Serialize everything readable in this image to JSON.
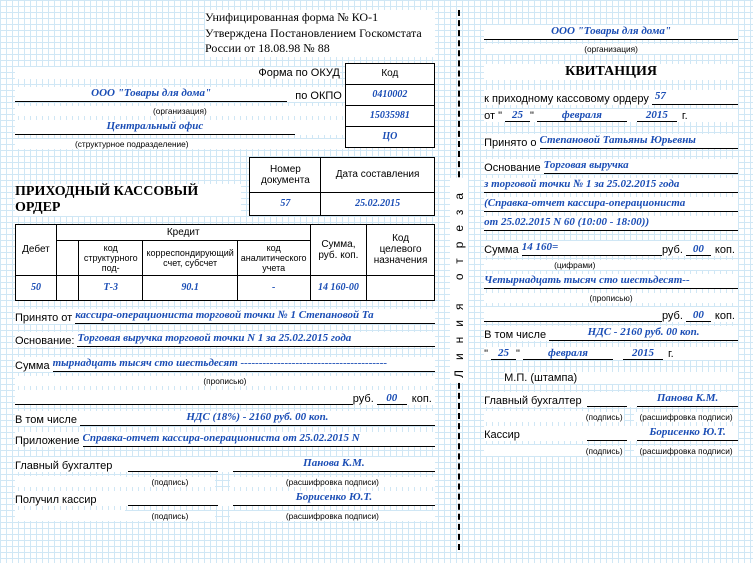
{
  "form": {
    "line1": "Унифицированная форма № КО-1",
    "line2": "Утверждена Постановлением Госкомстата",
    "line3": "России от 18.08.98 № 88"
  },
  "codes": {
    "kod": "Код",
    "okud_label": "Форма по ОКУД",
    "okud": "0410002",
    "okpo_label": "по ОКПО",
    "okpo": "15035981"
  },
  "org": {
    "name": "ООО \"Товары для дома\"",
    "org_sub": "(организация)",
    "unit": "Центральный офис",
    "unit_sub": "(структурное подразделение)",
    "unit_code": "ЦО"
  },
  "order": {
    "title": "ПРИХОДНЫЙ КАССОВЫЙ ОРДЕР",
    "num_header": "Номер документа",
    "date_header": "Дата составления",
    "num": "57",
    "date": "25.02.2015"
  },
  "table": {
    "debit": "Дебет",
    "credit": "Кредит",
    "c1": "код структурного под-",
    "c2": "корреспондирующий счет, субсчет",
    "c3": "код аналитического учета",
    "sum": "Сумма, руб. коп.",
    "purpose": "Код целевого назначения",
    "v_debit": "50",
    "v_c1": "Т-3",
    "v_c2": "90.1",
    "v_c3": "-",
    "v_sum": "14 160-00",
    "v_purpose": ""
  },
  "body": {
    "received_label": "Принято от",
    "received": "кассира-операциониста торговой точки № 1 Степановой Та",
    "basis_label": "Основание:",
    "basis": "Торговая выручка торговой точки N 1 за 25.02.2015 года",
    "sum_label": "Сумма",
    "sum_words": "тырнадцать тысяч сто шестьдесят ----------------------------------------",
    "sum_sub": "(прописью)",
    "rub": "руб.",
    "kop_val": "00",
    "kop": "коп.",
    "incl_label": "В том числе",
    "incl": "НДС (18%) - 2160 руб. 00 коп.",
    "attach_label": "Приложение",
    "attach": "Справка-отчет кассира-операциониста от 25.02.2015 N",
    "chief_label": "Главный бухгалтер",
    "sign_sub": "(подпись)",
    "decode_sub": "(расшифровка подписи)",
    "chief_name": "Панова К.М.",
    "cashier_got_label": "Получил кассир",
    "cashier_name": "Борисенко Ю.Т."
  },
  "receipt": {
    "title": "КВИТАНЦИЯ",
    "org": "ООО \"Товары для дома\"",
    "org_sub": "(организация)",
    "to_order": "к приходному кассовому ордеру",
    "num": "57",
    "ot": "от \"",
    "day": "25",
    "month": "февраля",
    "year": "2015",
    "g": "г.",
    "received_label": "Принято о",
    "received": "Степановой Татьяны Юрьевны",
    "basis_label": "Основание",
    "basis1": "Торговая выручка",
    "basis2": "з торговой точки № 1 за 25.02.2015 года",
    "basis3": "(Справка-отчет кассира-операциониста",
    "basis4": "от 25.02.2015 N 60 (10:00 - 18:00))",
    "sum_label": "Сумма",
    "sum_num": "14 160=",
    "sum_sub": "(цифрами)",
    "rub": "руб.",
    "kop_val": "00",
    "kop": "коп.",
    "sum_words": "Четырнадцать тысяч сто шестьдесят--",
    "words_sub": "(прописью)",
    "incl_label": "В том числе",
    "incl": "НДС - 2160 руб. 00 коп.",
    "mp": "М.П. (штампа)",
    "chief_label": "Главный бухгалтер",
    "chief_name": "Панова К.М.",
    "cashier_label": "Кассир",
    "cashier_name": "Борисенко Ю.Т.",
    "sign_sub": "(подпись)",
    "decode_sub": "(расшифровка подписи)"
  },
  "divider": "Линия отреза"
}
